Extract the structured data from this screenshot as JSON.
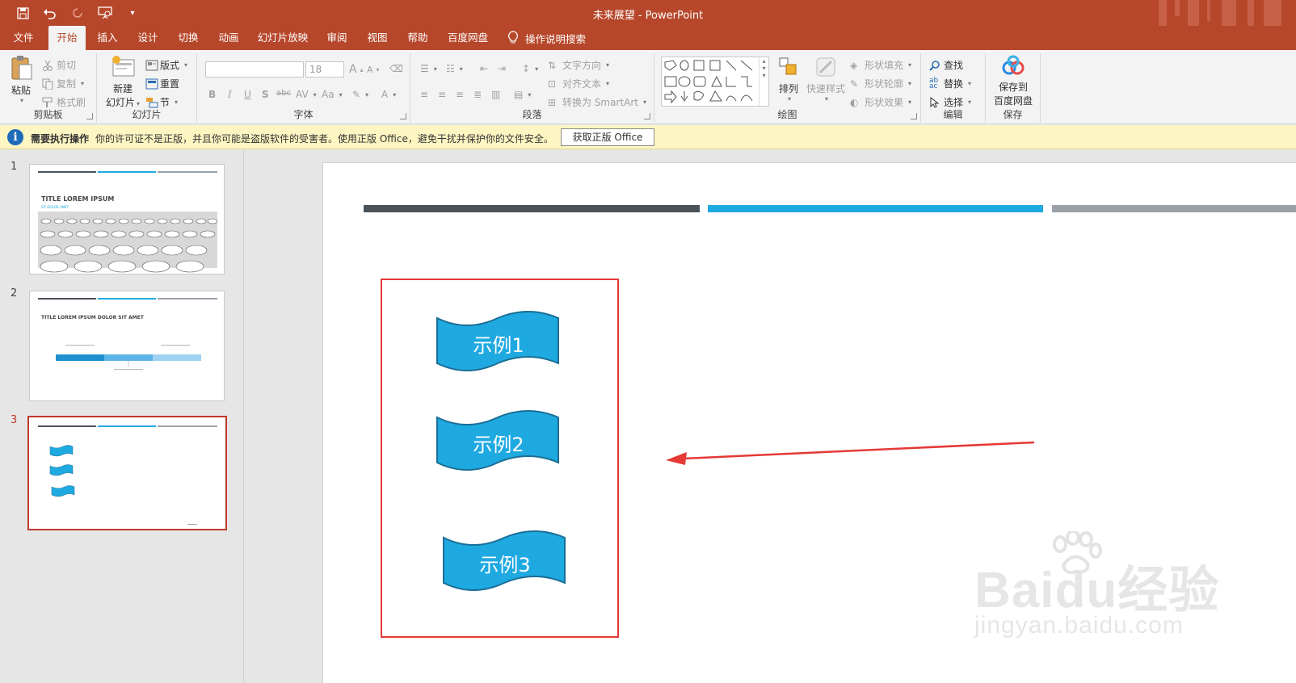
{
  "titlebar": {
    "title": "未来展望 - PowerPoint",
    "bg": "#b7472a"
  },
  "tabs": [
    "文件",
    "开始",
    "插入",
    "设计",
    "切换",
    "动画",
    "幻灯片放映",
    "审阅",
    "视图",
    "帮助",
    "百度网盘"
  ],
  "active_tab": "开始",
  "tell_me": "操作说明搜索",
  "ribbon": {
    "clipboard": {
      "label": "剪贴板",
      "paste": "粘贴",
      "cut": "剪切",
      "copy": "复制",
      "format_painter": "格式刷"
    },
    "slides": {
      "label": "幻灯片",
      "new_slide_line1": "新建",
      "new_slide_line2": "幻灯片",
      "layout": "版式",
      "reset": "重置",
      "section": "节"
    },
    "font": {
      "label": "字体",
      "font_name": "",
      "font_size": "18"
    },
    "paragraph": {
      "label": "段落",
      "text_direction": "文字方向",
      "align_text": "对齐文本",
      "convert_smartart": "转换为 SmartArt"
    },
    "drawing": {
      "label": "绘图",
      "arrange": "排列",
      "quick_styles": "快速样式",
      "shape_fill": "形状填充",
      "shape_outline": "形状轮廓",
      "shape_effects": "形状效果"
    },
    "editing": {
      "label": "编辑",
      "find": "查找",
      "replace": "替换",
      "select": "选择"
    },
    "save": {
      "label": "保存",
      "save_line1": "保存到",
      "save_line2": "百度网盘"
    }
  },
  "notification": {
    "title": "需要执行操作",
    "message": "你的许可证不是正版，并且你可能是盗版软件的受害者。使用正版 Office，避免干扰并保护你的文件安全。",
    "button": "获取正版 Office"
  },
  "thumbnails": [
    {
      "number": "1",
      "title": "TITLE LOREM IPSUM",
      "subtitle": "SIT DOLOR AMET"
    },
    {
      "number": "2",
      "title": "TITLE LOREM IPSUM DOLOR SIT AMET"
    },
    {
      "number": "3",
      "selected": true
    }
  ],
  "slide": {
    "banners": [
      "示例1",
      "示例2",
      "示例3"
    ],
    "colors": {
      "bar_dark": "#4a525a",
      "bar_blue": "#1fa9e1",
      "bar_gray": "#9aa1a8",
      "banner_fill": "#1fa9e1",
      "banner_stroke": "#1a6e96",
      "highlight": "#e53935"
    }
  },
  "watermark": {
    "brand": "Baidu经验",
    "url": "jingyan.baidu.com"
  }
}
